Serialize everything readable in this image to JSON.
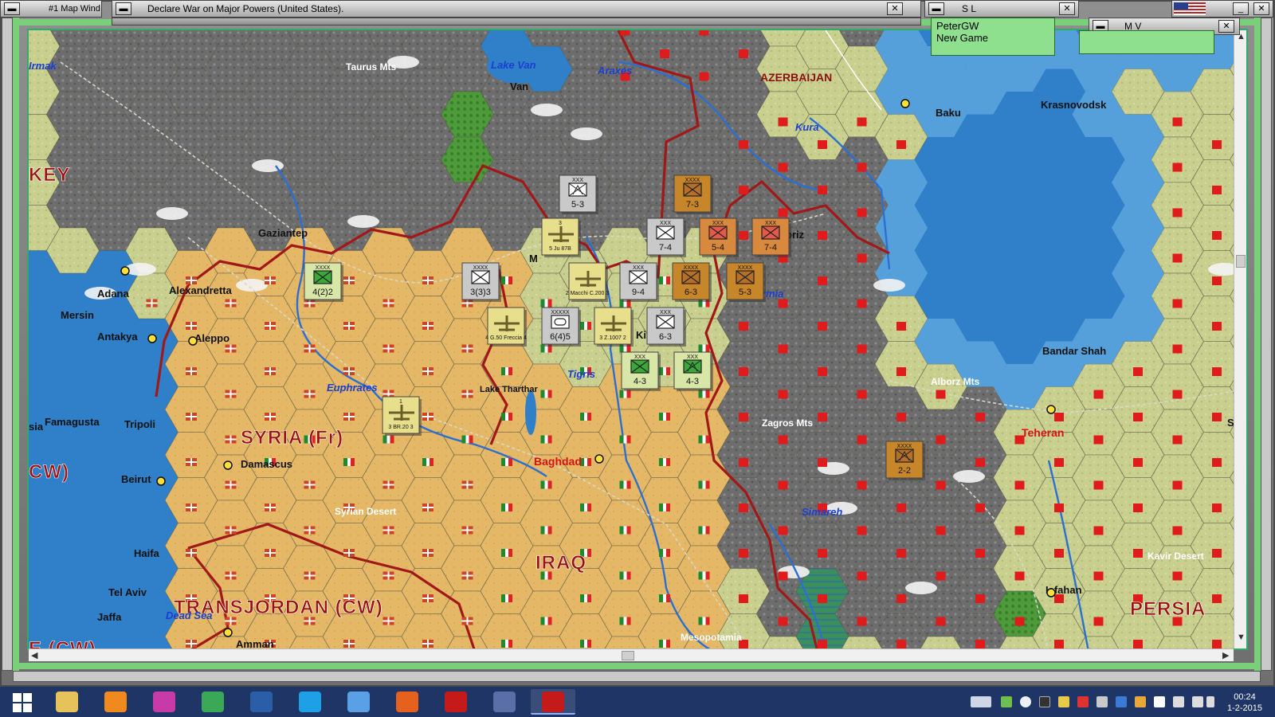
{
  "windows": {
    "map_window_title": "#1 Map Wind",
    "message_title": "Declare War on Major Powers (United States).",
    "sl_title": "S L",
    "mv_title": "M V"
  },
  "player_panel": {
    "name": "PeterGW",
    "status": "New Game"
  },
  "map": {
    "place_labels": [
      {
        "id": "irmak",
        "text": "Irmak",
        "style": "water"
      },
      {
        "id": "taurus",
        "text": "Taurus Mts",
        "style": "terrain"
      },
      {
        "id": "lake-van",
        "text": "Lake Van",
        "style": "water"
      },
      {
        "id": "van",
        "text": "Van",
        "style": "city"
      },
      {
        "id": "araxes",
        "text": "Araxes",
        "style": "water"
      },
      {
        "id": "azerbaijan",
        "text": "AZERBAIJAN",
        "style": "region-red"
      },
      {
        "id": "baku",
        "text": "Baku",
        "style": "city"
      },
      {
        "id": "kura",
        "text": "Kura",
        "style": "water"
      },
      {
        "id": "krasnovodsk",
        "text": "Krasnovodsk",
        "style": "city"
      },
      {
        "id": "turkey",
        "text": "KEY",
        "style": "country"
      },
      {
        "id": "gaziantep",
        "text": "Gaziantep",
        "style": "city"
      },
      {
        "id": "tabriz",
        "text": "briz",
        "style": "city"
      },
      {
        "id": "m",
        "text": "M",
        "style": "city"
      },
      {
        "id": "ki",
        "text": "Ki",
        "style": "city"
      },
      {
        "id": "urmia",
        "text": "rmia",
        "style": "water"
      },
      {
        "id": "adana",
        "text": "Adana",
        "style": "city"
      },
      {
        "id": "alexandretta",
        "text": "Alexandretta",
        "style": "city"
      },
      {
        "id": "mersin",
        "text": "Mersin",
        "style": "city"
      },
      {
        "id": "antakya",
        "text": "Antakya",
        "style": "city"
      },
      {
        "id": "aleppo",
        "text": "Aleppo",
        "style": "city"
      },
      {
        "id": "bandar-shah",
        "text": "Bandar Shah",
        "style": "city"
      },
      {
        "id": "alborz",
        "text": "Alborz Mts",
        "style": "terrain"
      },
      {
        "id": "euphrates",
        "text": "Euphrates",
        "style": "water"
      },
      {
        "id": "lake-tharthar",
        "text": "Lake Tharthar",
        "style": "terrain-dark"
      },
      {
        "id": "tigris",
        "text": "Tigris",
        "style": "water"
      },
      {
        "id": "famagusta",
        "text": "Famagusta",
        "style": "city"
      },
      {
        "id": "tripoli",
        "text": "Tripoli",
        "style": "city"
      },
      {
        "id": "syria",
        "text": "SYRIA (Fr)",
        "style": "country"
      },
      {
        "id": "zagros",
        "text": "Zagros Mts",
        "style": "terrain"
      },
      {
        "id": "teheran",
        "text": "Teheran",
        "style": "capital"
      },
      {
        "id": "sia",
        "text": "sia",
        "style": "city"
      },
      {
        "id": "sh",
        "text": "Sh",
        "style": "city"
      },
      {
        "id": "cw",
        "text": "CW)",
        "style": "country"
      },
      {
        "id": "damascus",
        "text": "Damascus",
        "style": "city"
      },
      {
        "id": "baghdad",
        "text": "Baghdad",
        "style": "capital"
      },
      {
        "id": "beirut",
        "text": "Beirut",
        "style": "city"
      },
      {
        "id": "syrian-desert",
        "text": "Syrian Desert",
        "style": "terrain"
      },
      {
        "id": "simareh",
        "text": "Simareh",
        "style": "water"
      },
      {
        "id": "haifa",
        "text": "Haifa",
        "style": "city"
      },
      {
        "id": "iraq",
        "text": "IRAQ",
        "style": "country"
      },
      {
        "id": "kavir",
        "text": "Kavir Desert",
        "style": "terrain"
      },
      {
        "id": "tel-aviv",
        "text": "Tel Aviv",
        "style": "city"
      },
      {
        "id": "transjordan",
        "text": "TRANSJORDAN (CW)",
        "style": "country"
      },
      {
        "id": "isfahan",
        "text": "Isfahan",
        "style": "city"
      },
      {
        "id": "persia",
        "text": "PERSIA",
        "style": "country"
      },
      {
        "id": "jaffa",
        "text": "Jaffa",
        "style": "city"
      },
      {
        "id": "dead-sea",
        "text": "Dead Sea",
        "style": "water"
      },
      {
        "id": "e-cw",
        "text": "E (CW)",
        "style": "country"
      },
      {
        "id": "amman",
        "text": "Amman",
        "style": "city"
      },
      {
        "id": "mesopotamia",
        "text": "Mesopotamia",
        "style": "terrain"
      }
    ],
    "units": [
      {
        "id": "u1",
        "strength": "5-3",
        "size": "XXX",
        "kind": "mountain",
        "side": "axis-grey"
      },
      {
        "id": "u2",
        "strength": "7-3",
        "size": "XXXX",
        "kind": "infantry",
        "side": "soviet"
      },
      {
        "id": "u3",
        "strength": "7-4",
        "size": "XXX",
        "kind": "infantry",
        "side": "axis-grey"
      },
      {
        "id": "u4",
        "strength": "5-4",
        "size": "XXX",
        "kind": "infantry",
        "side": "soviet-red"
      },
      {
        "id": "u5",
        "strength": "7-4",
        "size": "XXX",
        "kind": "infantry",
        "side": "soviet-red"
      },
      {
        "id": "u6",
        "strength": "5 Ju 87B",
        "size": "3",
        "kind": "air",
        "side": "axis-yellow"
      },
      {
        "id": "u7",
        "strength": "4(2)2",
        "size": "XXXX",
        "kind": "infantry",
        "side": "axis-green"
      },
      {
        "id": "u8",
        "strength": "3(3)3",
        "size": "XXXX",
        "kind": "infantry",
        "side": "axis-grey"
      },
      {
        "id": "u9",
        "strength": "2 Macchi C.200 3",
        "size": "",
        "kind": "air",
        "side": "axis-yellow"
      },
      {
        "id": "u10",
        "strength": "9-4",
        "size": "XXX",
        "kind": "infantry",
        "side": "axis-grey"
      },
      {
        "id": "u11",
        "strength": "6-3",
        "size": "XXXX",
        "kind": "infantry",
        "side": "soviet"
      },
      {
        "id": "u12",
        "strength": "5-3",
        "size": "XXXX",
        "kind": "infantry",
        "side": "soviet"
      },
      {
        "id": "u13",
        "strength": "4 G.50 Freccia 4",
        "size": "",
        "kind": "air",
        "side": "axis-yellow"
      },
      {
        "id": "u14",
        "strength": "6(4)5",
        "size": "XXXXX",
        "kind": "armor",
        "side": "axis-grey"
      },
      {
        "id": "u15",
        "strength": "3 Z.1007 2",
        "size": "",
        "kind": "air",
        "side": "axis-yellow"
      },
      {
        "id": "u16",
        "strength": "6-3",
        "size": "XXX",
        "kind": "infantry",
        "side": "axis-grey"
      },
      {
        "id": "u17",
        "strength": "4-3",
        "size": "XXX",
        "kind": "infantry",
        "side": "axis-green"
      },
      {
        "id": "u18",
        "strength": "4-3",
        "size": "XXX",
        "kind": "mountain",
        "side": "axis-green"
      },
      {
        "id": "u19",
        "strength": "3 BR.20 3",
        "size": "1",
        "kind": "air",
        "side": "axis-yellow"
      },
      {
        "id": "u20",
        "strength": "2-2",
        "size": "XXXX",
        "kind": "mountain",
        "side": "soviet"
      }
    ]
  },
  "taskbar": {
    "time": "00:24",
    "date": "1-2-2015",
    "apps": [
      "start",
      "file-explorer",
      "media-player",
      "paint",
      "chrome",
      "messenger",
      "skype",
      "thunderbird",
      "firefox",
      "wif-1",
      "paint-brush",
      "wif-2"
    ]
  },
  "colors": {
    "soviet": "#c8862a",
    "axis_grey": "#c9c9c9",
    "axis_green": "#d8e7a8",
    "axis_yellow": "#e8df8c",
    "border_red": "#a01818",
    "sea": "#2f7fc9"
  }
}
